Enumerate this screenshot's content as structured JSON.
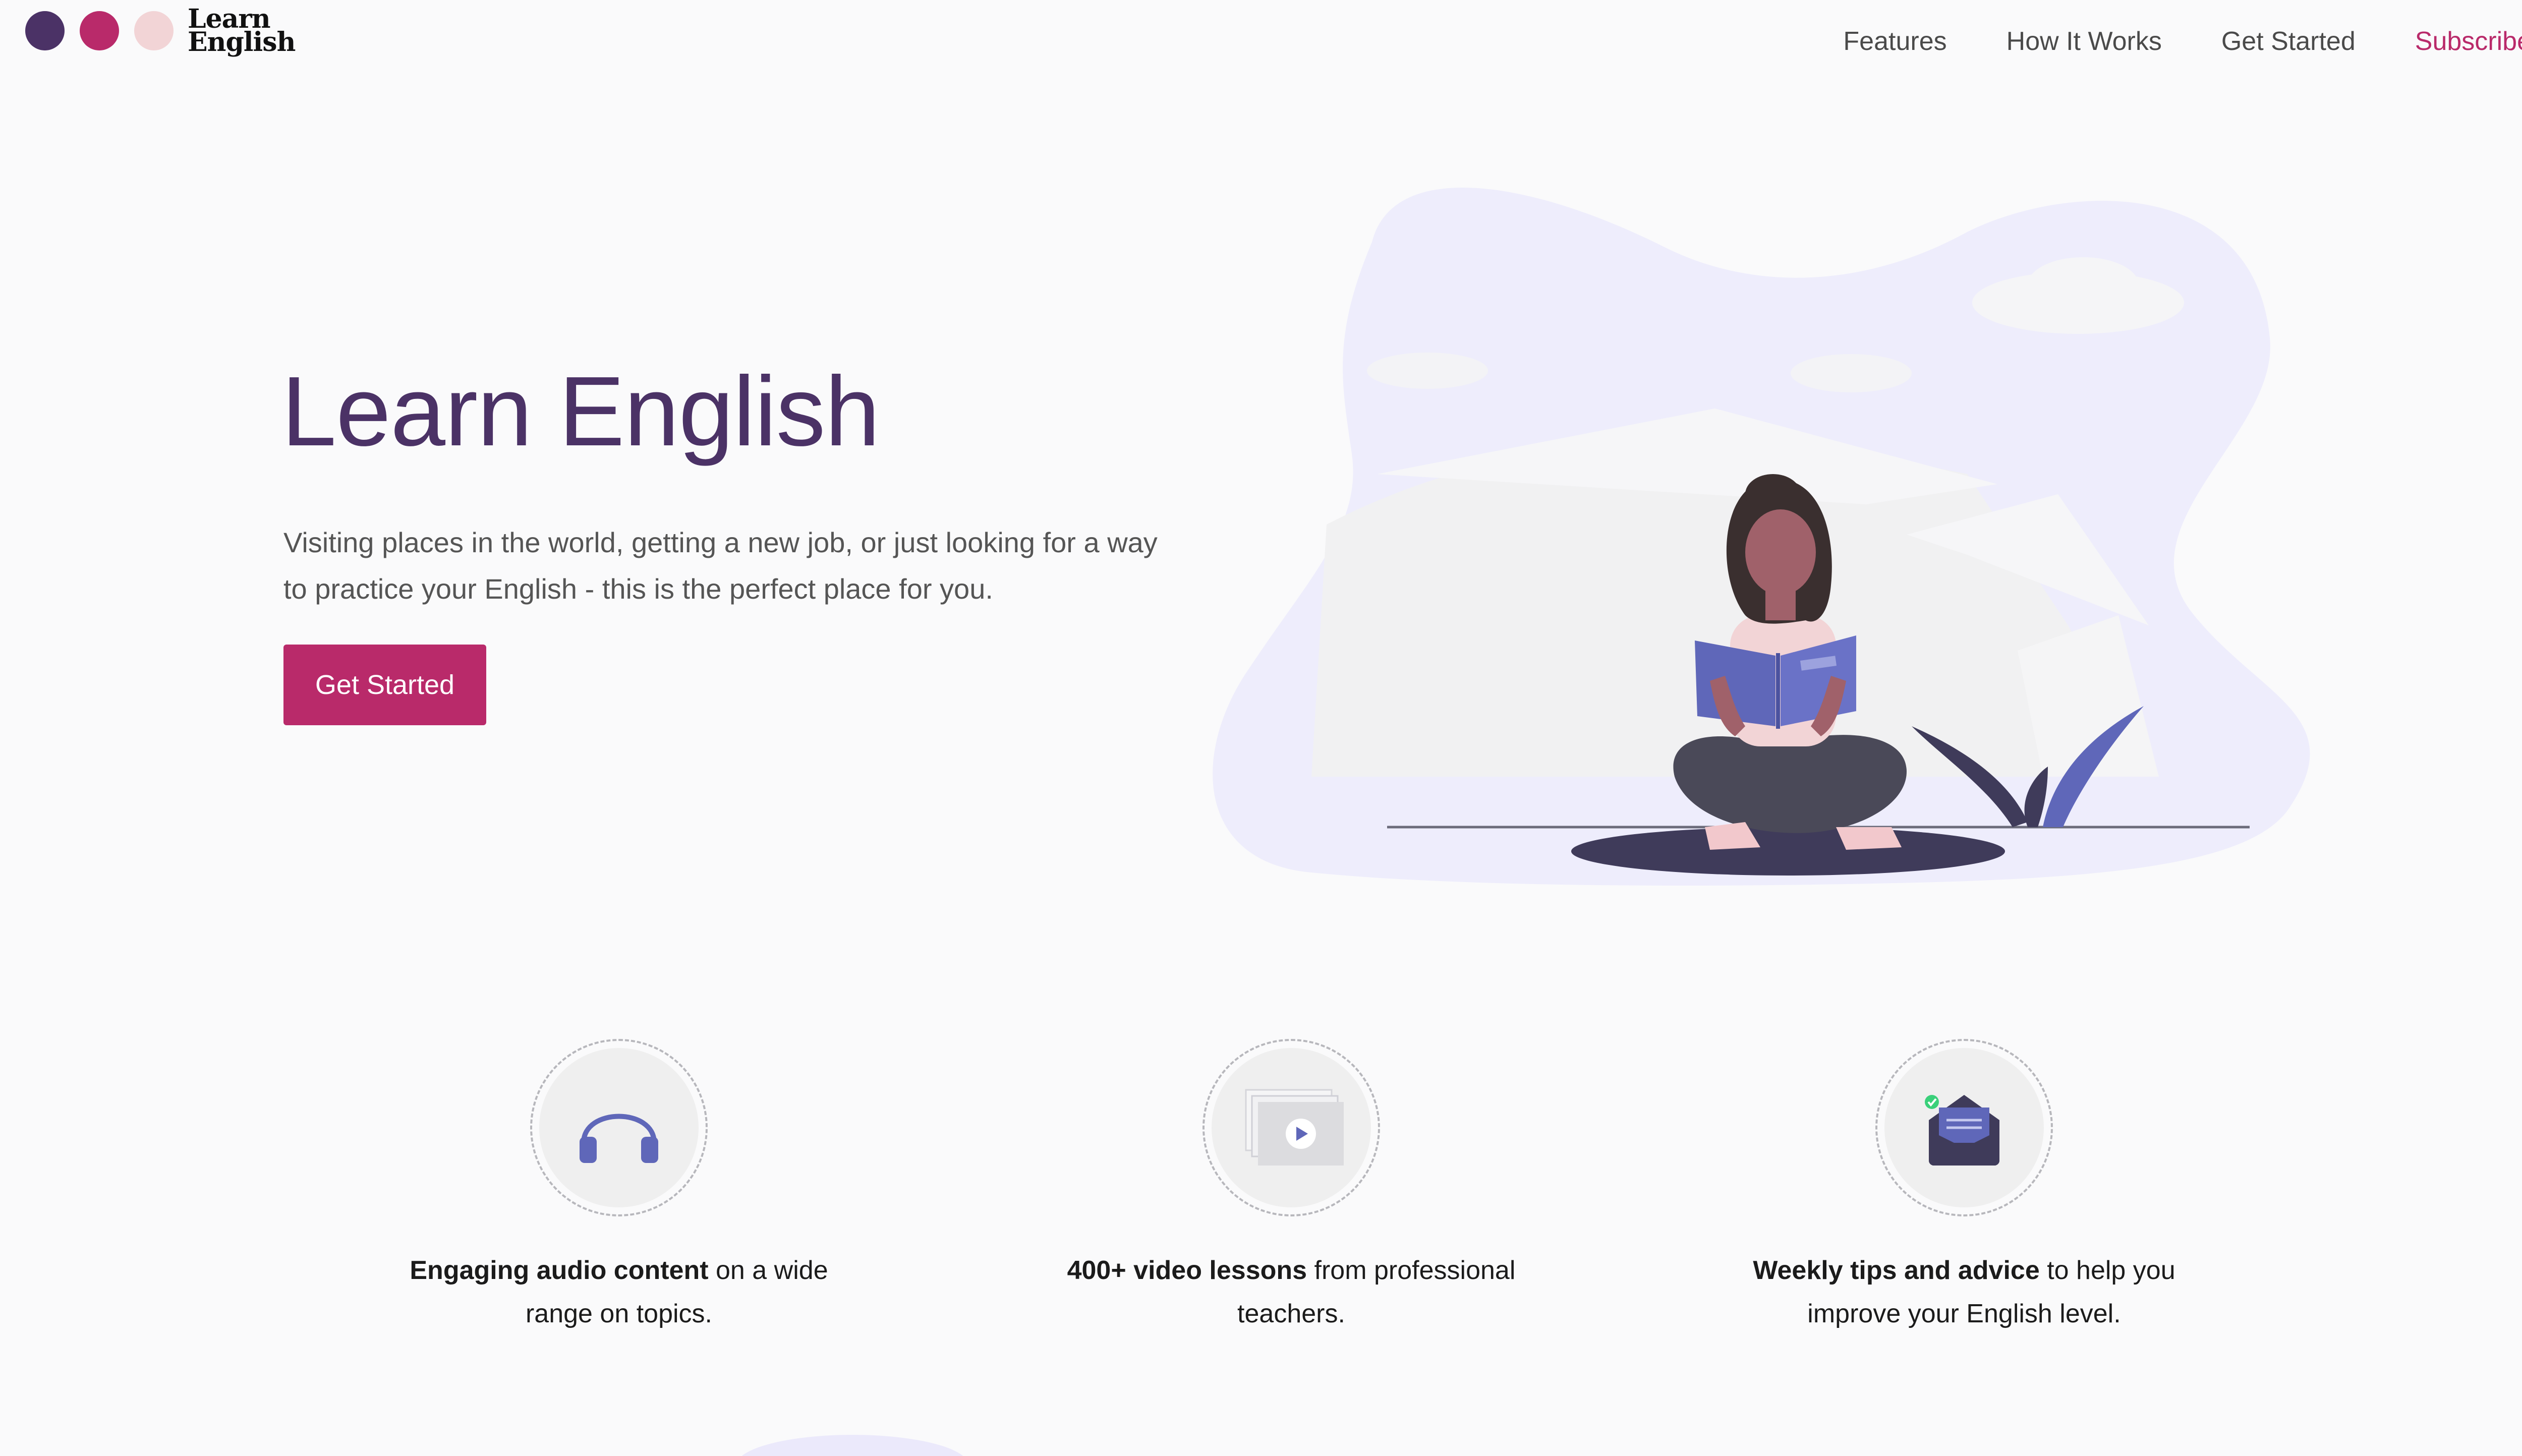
{
  "brand": {
    "logo_line1": "Learn",
    "logo_line2": "English",
    "dot_colors": [
      "#4b3266",
      "#b92a6a",
      "#f2d4d6"
    ]
  },
  "nav": {
    "features": "Features",
    "how_it_works": "How It Works",
    "get_started": "Get Started",
    "subscribe": "Subscribe"
  },
  "hero": {
    "title": "Learn English",
    "description": "Visiting places in the world, getting a new job, or just looking for a way to practice your English - this is the perfect place for you.",
    "button": "Get Started"
  },
  "features": [
    {
      "icon": "headphones-icon",
      "bold": "Engaging audio content",
      "text": " on a wide range on topics."
    },
    {
      "icon": "video-icon",
      "bold": "400+ video lessons",
      "text": " from professional teachers."
    },
    {
      "icon": "envelope-icon",
      "bold": "Weekly tips and advice",
      "text": " to help you improve your English level."
    }
  ],
  "colors": {
    "primary": "#b92a6a",
    "heading": "#4b3266",
    "accent_blue": "#5f67b9",
    "blob": "#eeedfc"
  }
}
